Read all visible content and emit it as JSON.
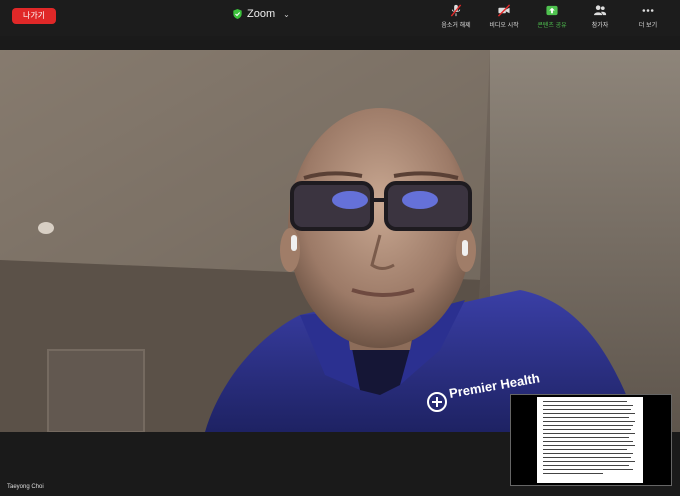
{
  "meeting": {
    "leave_label": "나가기",
    "title": "Zoom",
    "participant_name": "Taeyong Choi"
  },
  "toolbar": {
    "unmute": "음소거 해제",
    "start_video": "비디오 시작",
    "share_content": "콘텐츠 공유",
    "participants": "참가자",
    "more": "더 보기"
  },
  "video": {
    "jacket_text": "Premier Health"
  },
  "colors": {
    "leave": "#e02828",
    "share_green": "#4fc24f",
    "shield_green": "#3cc23c"
  }
}
